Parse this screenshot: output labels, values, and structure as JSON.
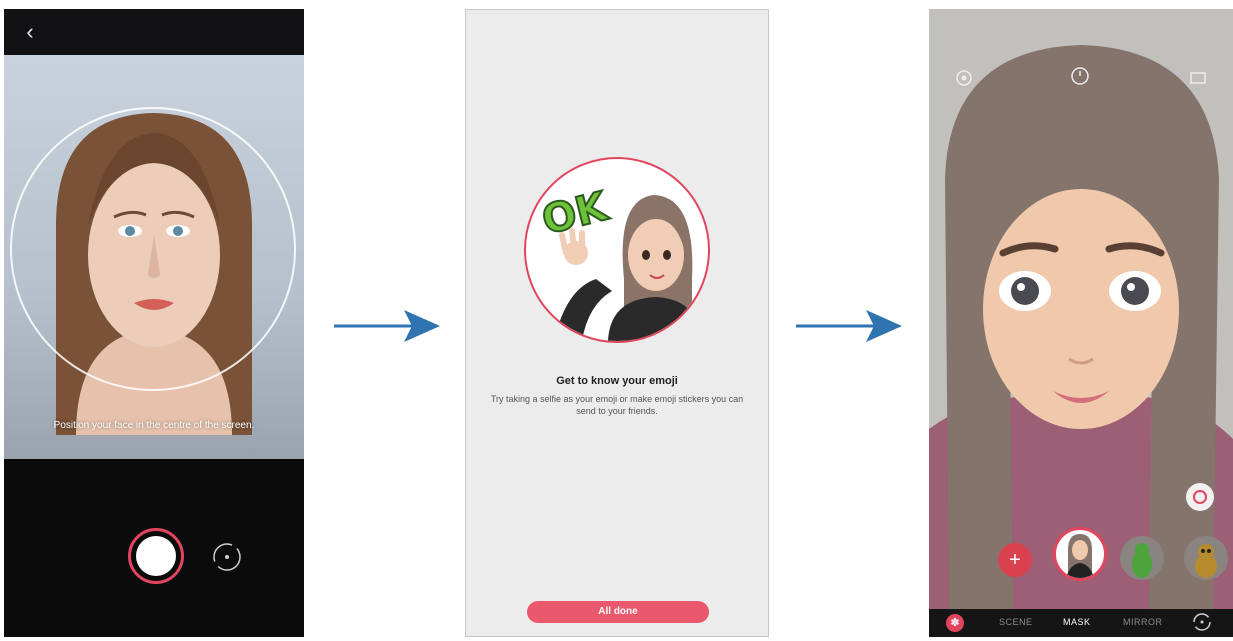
{
  "screen1": {
    "back_icon": "back-icon",
    "hint": "Position your face in the centre of the screen.",
    "shutter_color": "#e1455d",
    "switch_icon": "switch-camera-icon"
  },
  "screen2": {
    "title": "Get to know your emoji",
    "description": "Try taking a selfie as your emoji or make emoji stickers you can send to your friends.",
    "sticker_text": "OK",
    "done_label": "All done",
    "accent": "#e9586c"
  },
  "screen3": {
    "modes": [
      "SCENE",
      "MASK",
      "MIRROR"
    ],
    "active_mode": "MASK",
    "accent": "#e1455d",
    "icons": [
      "settings-icon",
      "timer-icon",
      "aspect-ratio-icon",
      "sticker-toggle-icon",
      "add-emoji-icon",
      "flip-camera-icon"
    ]
  }
}
